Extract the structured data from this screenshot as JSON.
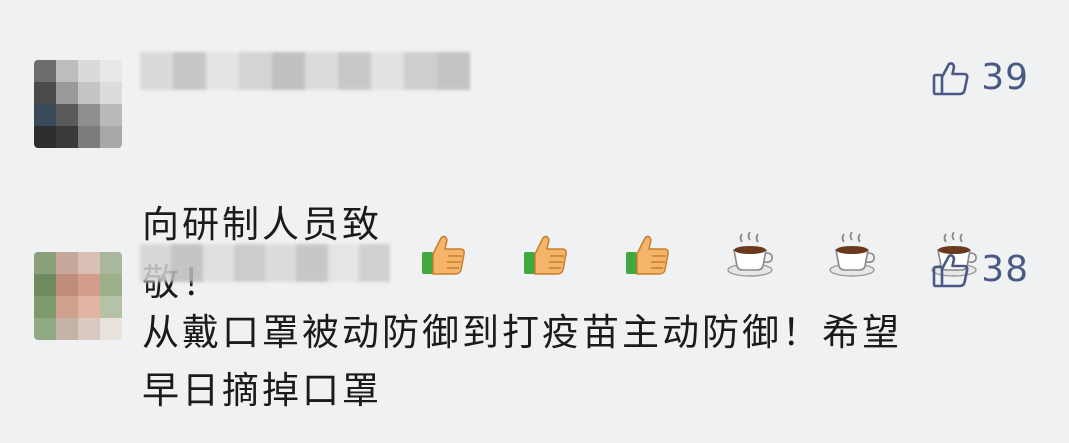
{
  "comments": [
    {
      "text": "向研制人员致敬！",
      "likes": "39",
      "reactions": [
        "thumbs-up-icon",
        "thumbs-up-icon",
        "thumbs-up-icon",
        "coffee-icon",
        "coffee-icon",
        "coffee-icon"
      ]
    },
    {
      "text": "从戴口罩被动防御到打疫苗主动防御！希望\n早日摘掉口罩",
      "likes": "38"
    }
  ],
  "colors": {
    "background": "#f0f1f3",
    "like_icon": "#4b5a84",
    "text": "#1b1b1b"
  }
}
